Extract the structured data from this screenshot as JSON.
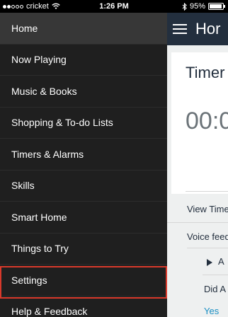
{
  "status_bar": {
    "carrier": "cricket",
    "time": "1:26 PM",
    "battery": "95%",
    "battery_level": 0.95,
    "signal_bars_filled": 2,
    "signal_bars_total": 5
  },
  "menu": {
    "items": [
      {
        "label": "Home"
      },
      {
        "label": "Now Playing"
      },
      {
        "label": "Music & Books"
      },
      {
        "label": "Shopping & To-do Lists"
      },
      {
        "label": "Timers & Alarms"
      },
      {
        "label": "Skills"
      },
      {
        "label": "Smart Home"
      },
      {
        "label": "Things to Try"
      },
      {
        "label": "Settings"
      },
      {
        "label": "Help & Feedback"
      }
    ],
    "active_item": "Home",
    "highlighted_item": "Settings"
  },
  "content": {
    "header_title": "Hor",
    "card_title": "Timer",
    "card_time": "00:0",
    "view_timers": "View Time",
    "voice_feedback": "Voice feed",
    "play_row": "A",
    "did_row": "Did A",
    "yes_link": "Yes"
  },
  "colors": {
    "menu_bg": "#1f1f1f",
    "active_item_bg": "#373737",
    "highlight_border": "#d8392b",
    "header_bg": "#232f3e",
    "link": "#1a8fc4"
  }
}
